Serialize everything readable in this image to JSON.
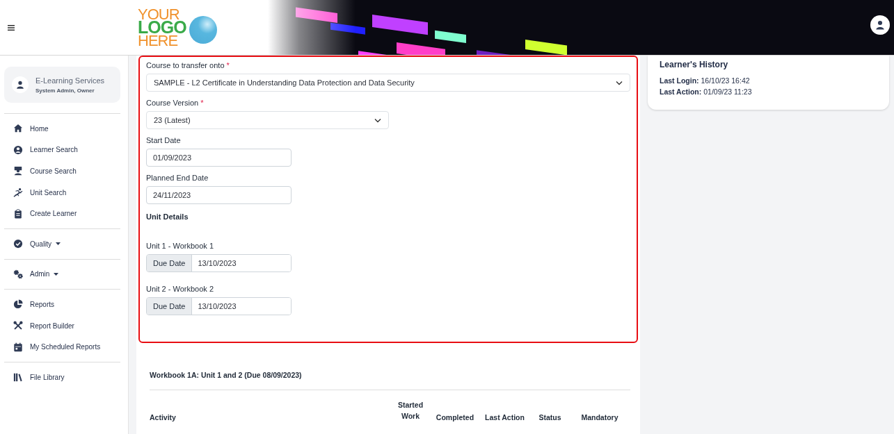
{
  "header": {
    "logo": {
      "line_1": "YOUR",
      "line_2": "LOGO",
      "line_3": "HERE"
    }
  },
  "sidebar": {
    "profile": {
      "name": "E-Learning Services",
      "role": "System Admin, Owner"
    },
    "groups": [
      {
        "items": [
          {
            "label": "Home",
            "dropdown": false
          },
          {
            "label": "Learner Search",
            "dropdown": false
          },
          {
            "label": "Course Search",
            "dropdown": false
          },
          {
            "label": "Unit Search",
            "dropdown": false
          },
          {
            "label": "Create Learner",
            "dropdown": false
          }
        ]
      },
      {
        "items": [
          {
            "label": "Quality",
            "dropdown": true
          }
        ]
      },
      {
        "items": [
          {
            "label": "Admin",
            "dropdown": true
          }
        ]
      },
      {
        "items": [
          {
            "label": "Reports",
            "dropdown": false
          },
          {
            "label": "Report Builder",
            "dropdown": false
          },
          {
            "label": "My Scheduled Reports",
            "dropdown": false
          }
        ]
      },
      {
        "items": [
          {
            "label": "File Library",
            "dropdown": false
          }
        ]
      }
    ]
  },
  "form": {
    "fields": [
      {
        "kind": "select",
        "label": "Course to transfer onto",
        "required": true,
        "value": "SAMPLE - L2 Certificate in Understanding Data Protection and Data Security"
      },
      {
        "kind": "select",
        "label": "Course Version",
        "required": true,
        "value": "23 (Latest)"
      },
      {
        "kind": "date",
        "label": "Start Date",
        "required": false,
        "value": "01/09/2023"
      },
      {
        "kind": "date",
        "label": "Planned End Date",
        "required": false,
        "value": "24/11/2023"
      }
    ],
    "required_mark": "*",
    "unit_details_title": "Unit Details",
    "units": [
      {
        "label": "Unit 1 - Workbook 1",
        "prefix": "Due Date",
        "value": "13/10/2023"
      },
      {
        "label": "Unit 2 - Workbook 2",
        "prefix": "Due Date",
        "value": "13/10/2023"
      }
    ]
  },
  "workbook": {
    "title": "Workbook 1A: Unit 1 and 2 (Due 08/09/2023)",
    "columns": [
      "Activity",
      "Started Work",
      "Completed",
      "Last Action",
      "Status",
      "Mandatory"
    ]
  },
  "learners_history": {
    "title": "Learner's History",
    "lines": [
      "**Last Login:** 16/10/23 16:42",
      "**Last Action:** 01/09/23 11:23"
    ]
  }
}
